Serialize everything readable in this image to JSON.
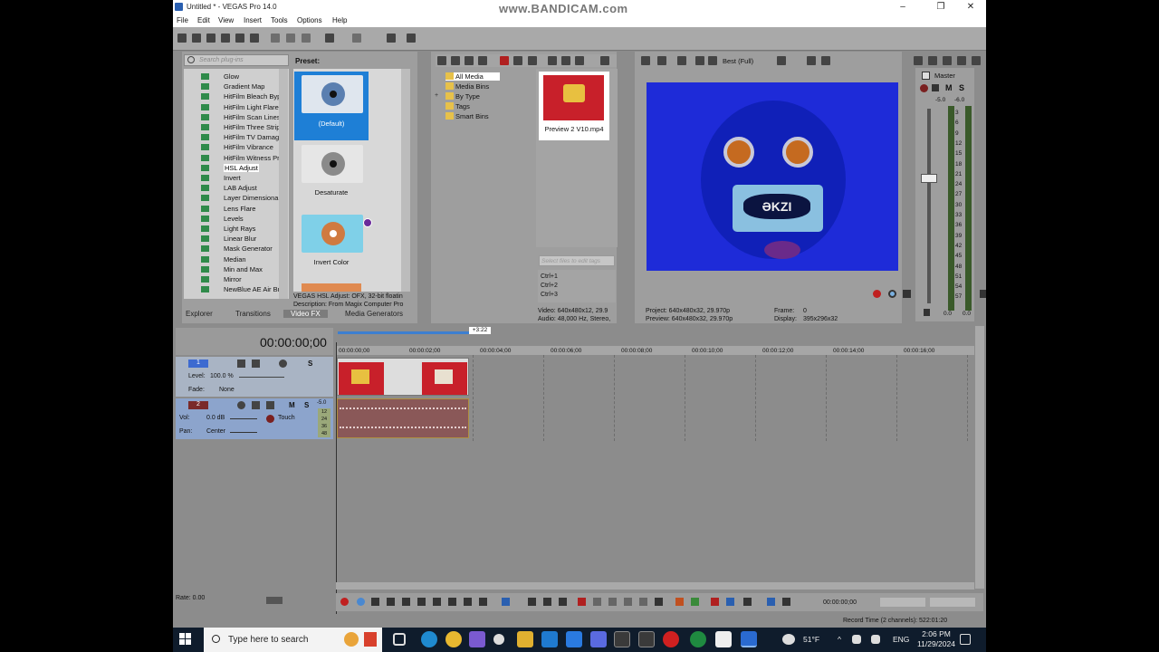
{
  "window": {
    "title": "Untitled * - VEGAS Pro 14.0",
    "watermark": "www.BANDICAM.com",
    "minimize": "–",
    "maximize": "❐",
    "close": "✕"
  },
  "menu": [
    "File",
    "Edit",
    "View",
    "Insert",
    "Tools",
    "Options",
    "Help"
  ],
  "fx_browser": {
    "search_placeholder": "Search plug-ins",
    "items": [
      "Glow",
      "Gradient Map",
      "HitFilm Bleach Byp",
      "HitFilm Light Flare",
      "HitFilm Scan Lines",
      "HitFilm Three Strip",
      "HitFilm TV Damage",
      "HitFilm Vibrance",
      "HitFilm Witness Pr",
      "HSL Adjust",
      "Invert",
      "LAB Adjust",
      "Layer Dimensional",
      "Lens Flare",
      "Levels",
      "Light Rays",
      "Linear Blur",
      "Mask Generator",
      "Median",
      "Min and Max",
      "Mirror",
      "NewBlue AE Air Br"
    ],
    "selected": "HSL Adjust",
    "preset_label": "Preset:",
    "presets": [
      "(Default)",
      "Desaturate",
      "Invert Color"
    ],
    "description_line1": "VEGAS HSL Adjust: OFX, 32-bit floatin",
    "description_line2": "Description: From Magix Computer Pro",
    "tabs": [
      "Explorer",
      "Transitions",
      "Video FX",
      "Media Generators"
    ],
    "active_tab": "Video FX"
  },
  "media": {
    "tree": [
      "All Media",
      "Media Bins",
      "By Type",
      "Tags",
      "Smart Bins"
    ],
    "expander": "+",
    "thumb_label": "Preview 2 V10.mp4",
    "tag_placeholder": "Select files to edit tags",
    "shortcuts": [
      "Ctrl+1",
      "Ctrl+2",
      "Ctrl+3"
    ],
    "info_video": "Video: 640x480x12, 29.9",
    "info_audio": "Audio: 48,000 Hz, Stereo,"
  },
  "preview": {
    "quality": "Best (Full)",
    "project": "Project:   640x480x32, 29.970p",
    "preview": "Preview:  640x480x32, 29.970p",
    "frame_label": "Frame:",
    "frame_value": "0",
    "display_label": "Display:",
    "display_value": "395x296x32",
    "mouth_text": "ƏKZI"
  },
  "master": {
    "label": "Master",
    "m": "M",
    "s": "S",
    "peaks": [
      "-5.0",
      "-6.0"
    ],
    "scale": [
      "3",
      "6",
      "9",
      "12",
      "15",
      "18",
      "21",
      "24",
      "27",
      "30",
      "33",
      "36",
      "39",
      "42",
      "45",
      "48",
      "51",
      "54",
      "57"
    ],
    "bottom_values": [
      "0.0",
      "0.0"
    ]
  },
  "timeline": {
    "timecode": "00:00:00;00",
    "marker": "+3:22",
    "ruler": [
      "00:00:00;00",
      "00:00:02;00",
      "00:00:04;00",
      "00:00:06;00",
      "00:00:08;00",
      "00:00:10;00",
      "00:00:12;00",
      "00:00:14;00",
      "00:00:16;00"
    ],
    "track1": {
      "number": "1",
      "level_label": "Level:",
      "level_value": "100.0 %",
      "fade_label": "Fade:",
      "fade_value": "None",
      "s": "S"
    },
    "track2": {
      "number": "2",
      "vol_label": "Vol:",
      "vol_value": "0.0 dB",
      "pan_label": "Pan:",
      "pan_value": "Center",
      "mode": "Touch",
      "m": "M",
      "s": "S",
      "meter_top": "-5.0",
      "meter_vals": [
        "12",
        "24",
        "36",
        "48"
      ]
    },
    "rate": "Rate: 0.00",
    "transport_timecode": "00:00:00;00",
    "record_time": "Record Time (2 channels): 522:01:20"
  },
  "taskbar": {
    "search_text": "Type here to search",
    "weather": "51°F",
    "lang": "ENG",
    "time": "2:06 PM",
    "date": "11/29/2024"
  }
}
